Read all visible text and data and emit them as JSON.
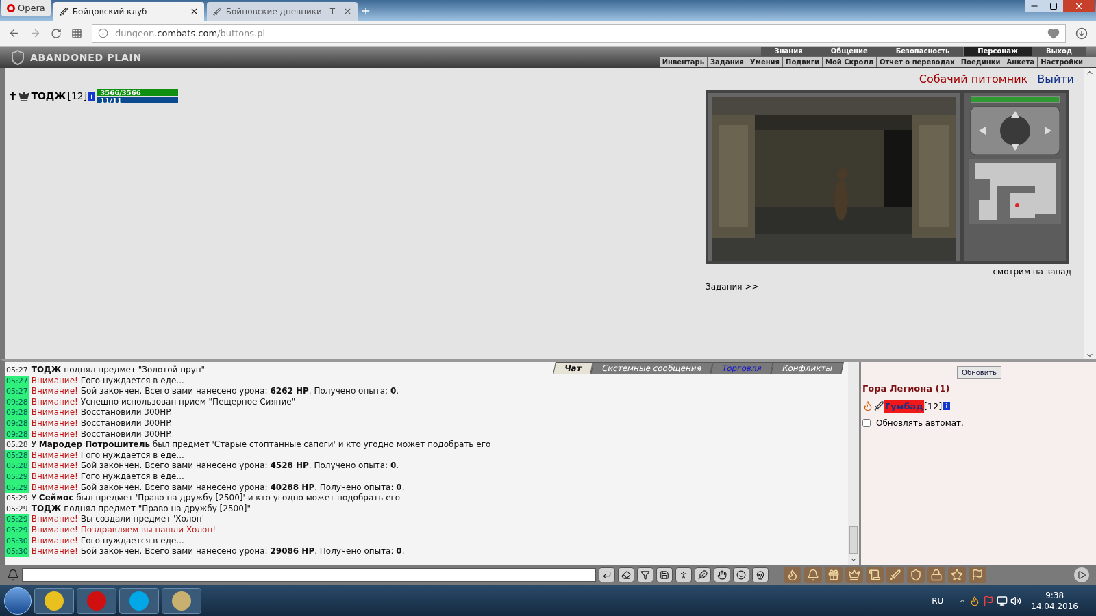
{
  "browser": {
    "menu_label": "Opera",
    "tabs": [
      {
        "title": "Бойцовский клуб",
        "selected": true
      },
      {
        "title": "Бойцовские дневники - Т",
        "selected": false
      }
    ],
    "address": {
      "host": "dungeon.",
      "domain": "combats.com",
      "path": "/buttons.pl"
    }
  },
  "game_header": {
    "logo": "ABANDONED PLAIN",
    "main_menu": [
      {
        "label": "Знания",
        "selected": false
      },
      {
        "label": "Общение",
        "selected": false
      },
      {
        "label": "Безопасность",
        "selected": false
      },
      {
        "label": "Персонаж",
        "selected": true
      },
      {
        "label": "Выход",
        "selected": false
      }
    ],
    "sub_menu": [
      "Инвентарь",
      "Задания",
      "Умения",
      "Подвиги",
      "Мой Скролл",
      "Отчет о переводах",
      "Поединки",
      "Анкета",
      "Настройки"
    ]
  },
  "character": {
    "mark": "✝",
    "name": "ТОДЖ",
    "level": "[12]",
    "info": "i",
    "hp": {
      "reading": "3566/3566",
      "level": 1
    },
    "mana": {
      "reading": "11/11",
      "level": 1
    }
  },
  "location": {
    "title": "Собачий питомник",
    "exit": "Выйти",
    "direction": "смотрим на запад",
    "quests_link": "Задания >>",
    "stamina": {
      "level": 1
    }
  },
  "chat": {
    "tabs": [
      {
        "label": "Чат",
        "selected": true
      },
      {
        "label": "Системные сообщения",
        "selected": false
      },
      {
        "label": "Торговля",
        "selected": false
      },
      {
        "label": "Конфликты",
        "selected": false
      }
    ],
    "messages": [
      {
        "time": "05:27",
        "highlighted": false,
        "text": "**ТОДЖ** поднял предмет \"Золотой прун\"",
        "alert": false
      },
      {
        "time": "05:27",
        "highlighted": true,
        "label": "Внимание!",
        "text": "Гого нуждается в еде...",
        "alert": false
      },
      {
        "time": "05:27",
        "highlighted": true,
        "label": "Внимание!",
        "text": "Бой закончен. Всего вами нанесено урона: **6262 HP**. Получено опыта: **0**.",
        "alert": false
      },
      {
        "time": "09:28",
        "highlighted": true,
        "label": "Внимание!",
        "text": "Успешно использован прием \"Пещерное Сияние\"",
        "alert": false
      },
      {
        "time": "09:28",
        "highlighted": true,
        "label": "Внимание!",
        "text": "Восстановили 300HP.",
        "alert": false
      },
      {
        "time": "09:28",
        "highlighted": true,
        "label": "Внимание!",
        "text": "Восстановили 300HP.",
        "alert": false
      },
      {
        "time": "09:28",
        "highlighted": true,
        "label": "Внимание!",
        "text": "Восстановили 300HP.",
        "alert": false
      },
      {
        "time": "05:28",
        "highlighted": false,
        "text": "У **Мародер Потрошитель** был предмет 'Старые стоптанные сапоги' и кто угодно может подобрать его",
        "alert": false
      },
      {
        "time": "05:28",
        "highlighted": true,
        "label": "Внимание!",
        "text": "Гого нуждается в еде...",
        "alert": false
      },
      {
        "time": "05:28",
        "highlighted": true,
        "label": "Внимание!",
        "text": "Бой закончен. Всего вами нанесено урона: **4528 HP**. Получено опыта: **0**.",
        "alert": false
      },
      {
        "time": "05:29",
        "highlighted": true,
        "label": "Внимание!",
        "text": "Гого нуждается в еде...",
        "alert": false
      },
      {
        "time": "05:29",
        "highlighted": true,
        "label": "Внимание!",
        "text": "Бой закончен. Всего вами нанесено урона: **40288 HP**. Получено опыта: **0**.",
        "alert": false
      },
      {
        "time": "05:29",
        "highlighted": false,
        "text": "У **Сеймос** был предмет 'Право на дружбу [2500]' и кто угодно может подобрать его",
        "alert": false
      },
      {
        "time": "05:29",
        "highlighted": false,
        "text": "**ТОДЖ** поднял предмет \"Право на дружбу [2500]\"",
        "alert": false
      },
      {
        "time": "05:29",
        "highlighted": true,
        "label": "Внимание!",
        "text": "Вы создали предмет 'Холон'",
        "alert": false
      },
      {
        "time": "05:29",
        "highlighted": true,
        "label": "Внимание!",
        "text": "Поздравляем вы нашли Холон!",
        "alert": true
      },
      {
        "time": "05:30",
        "highlighted": true,
        "label": "Внимание!",
        "text": "Гого нуждается в еде...",
        "alert": false
      },
      {
        "time": "05:30",
        "highlighted": true,
        "label": "Внимание!",
        "text": "Бой закончен. Всего вами нанесено урона: **29086 HP**. Получено опыта: **0**.",
        "alert": false
      }
    ]
  },
  "online": {
    "refresh_button": "Обновить",
    "room": "Гора Легиона (1)",
    "players": [
      {
        "name": "Гумбад",
        "level": "[12]",
        "info": "i"
      }
    ],
    "auto_refresh": {
      "label": "Обновлять автомат.",
      "checked": false
    }
  },
  "taskbar": {
    "language": "RU",
    "time": "9:38",
    "date": "14.04.2016"
  }
}
